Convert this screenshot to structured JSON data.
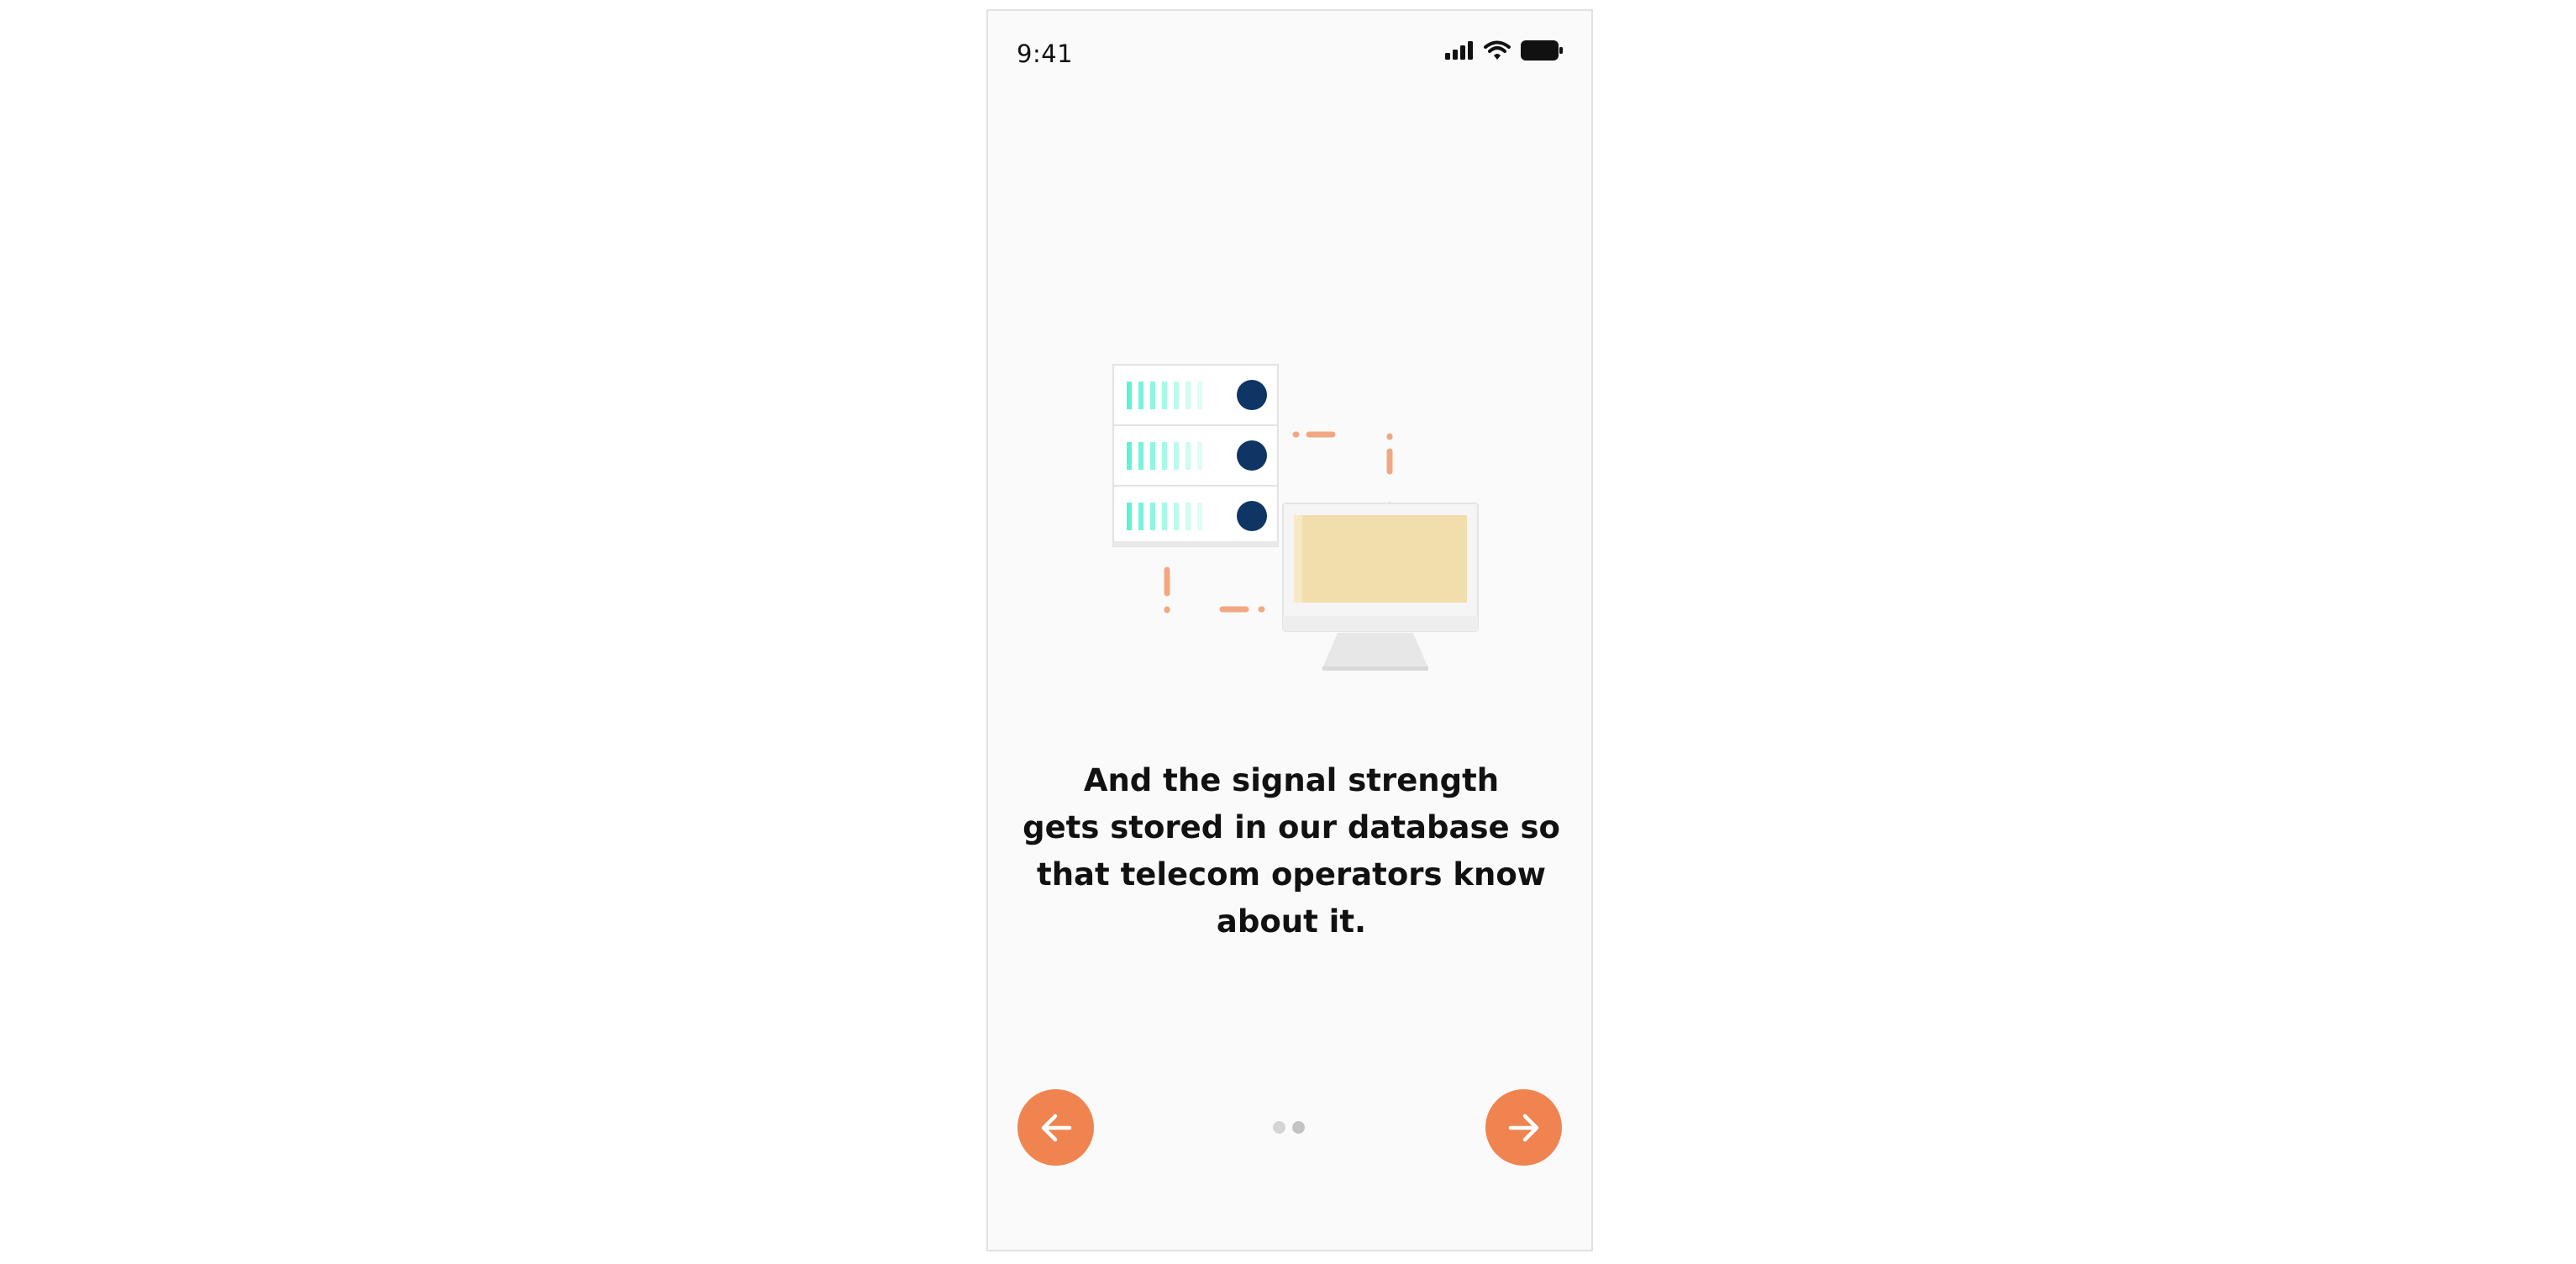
{
  "status_bar": {
    "time": "9:41",
    "icons": [
      "signal-icon",
      "wifi-icon",
      "battery-icon"
    ]
  },
  "illustration": {
    "subject": "server-rack-to-monitor-connection",
    "colors": {
      "server_body": "#ffffff",
      "server_border": "#e3e3e3",
      "server_bars": "#5ff2d4",
      "server_dots": "#0e3563",
      "connector": "#f1a882",
      "monitor_screen": "#f2deac",
      "monitor_frame": "#f5f5f5"
    }
  },
  "onboarding": {
    "message_lines": [
      "And the signal strength",
      "gets stored in our database so",
      "that telecom operators know",
      "about it."
    ],
    "pager": {
      "total": 2,
      "current": 2
    },
    "prev_icon": "arrow-left-icon",
    "next_icon": "arrow-right-icon",
    "accent_color": "#f08450"
  }
}
